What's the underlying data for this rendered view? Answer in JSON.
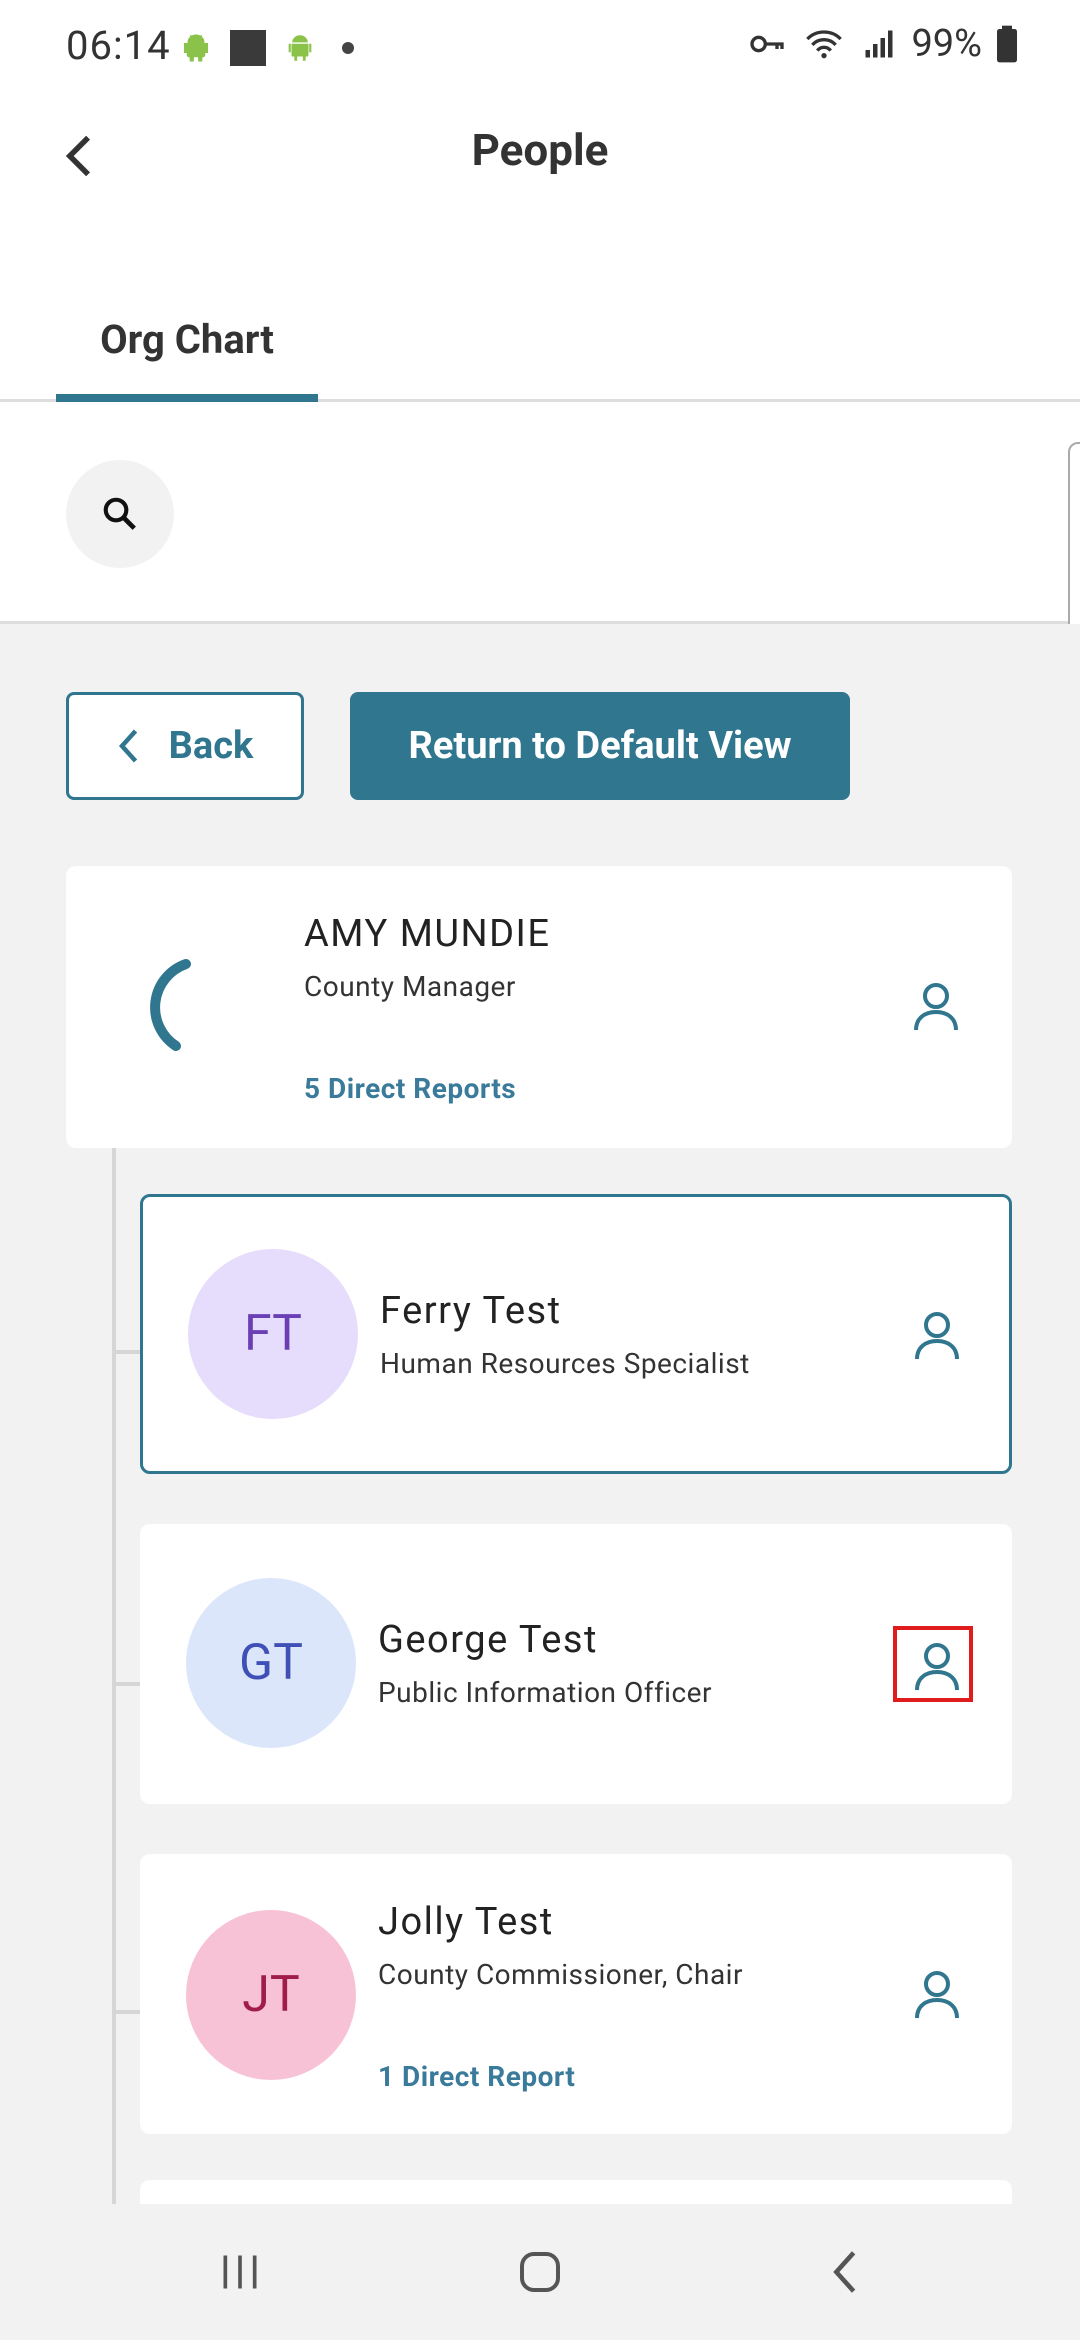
{
  "status": {
    "time": "06:14",
    "battery": "99%"
  },
  "header": {
    "title": "People"
  },
  "tabs": [
    {
      "label": "Org Chart",
      "active": true
    }
  ],
  "buttons": {
    "back": "Back",
    "return_default": "Return to Default View"
  },
  "manager": {
    "name": "AMY  MUNDIE",
    "role": "County Manager",
    "reports": "5 Direct Reports"
  },
  "people": [
    {
      "initials": "FT",
      "name": "Ferry  Test",
      "role": "Human Resources Specialist",
      "reports": "",
      "avatar_bg": "#e6dcfb",
      "avatar_fg": "#6a3fb5"
    },
    {
      "initials": "GT",
      "name": "George  Test",
      "role": "Public Information Officer",
      "reports": "",
      "avatar_bg": "#dce6fb",
      "avatar_fg": "#3f4fb5"
    },
    {
      "initials": "JT",
      "name": "Jolly  Test",
      "role": "County Commissioner, Chair",
      "reports": "1 Direct Report",
      "avatar_bg": "#f8c2d6",
      "avatar_fg": "#a01d4a"
    }
  ],
  "colors": {
    "accent": "#2f768e",
    "link": "#3a7a9a",
    "highlight": "#e01b1b"
  },
  "icons": {
    "search": "search-icon",
    "person": "person-icon",
    "back": "chevron-left-icon"
  }
}
